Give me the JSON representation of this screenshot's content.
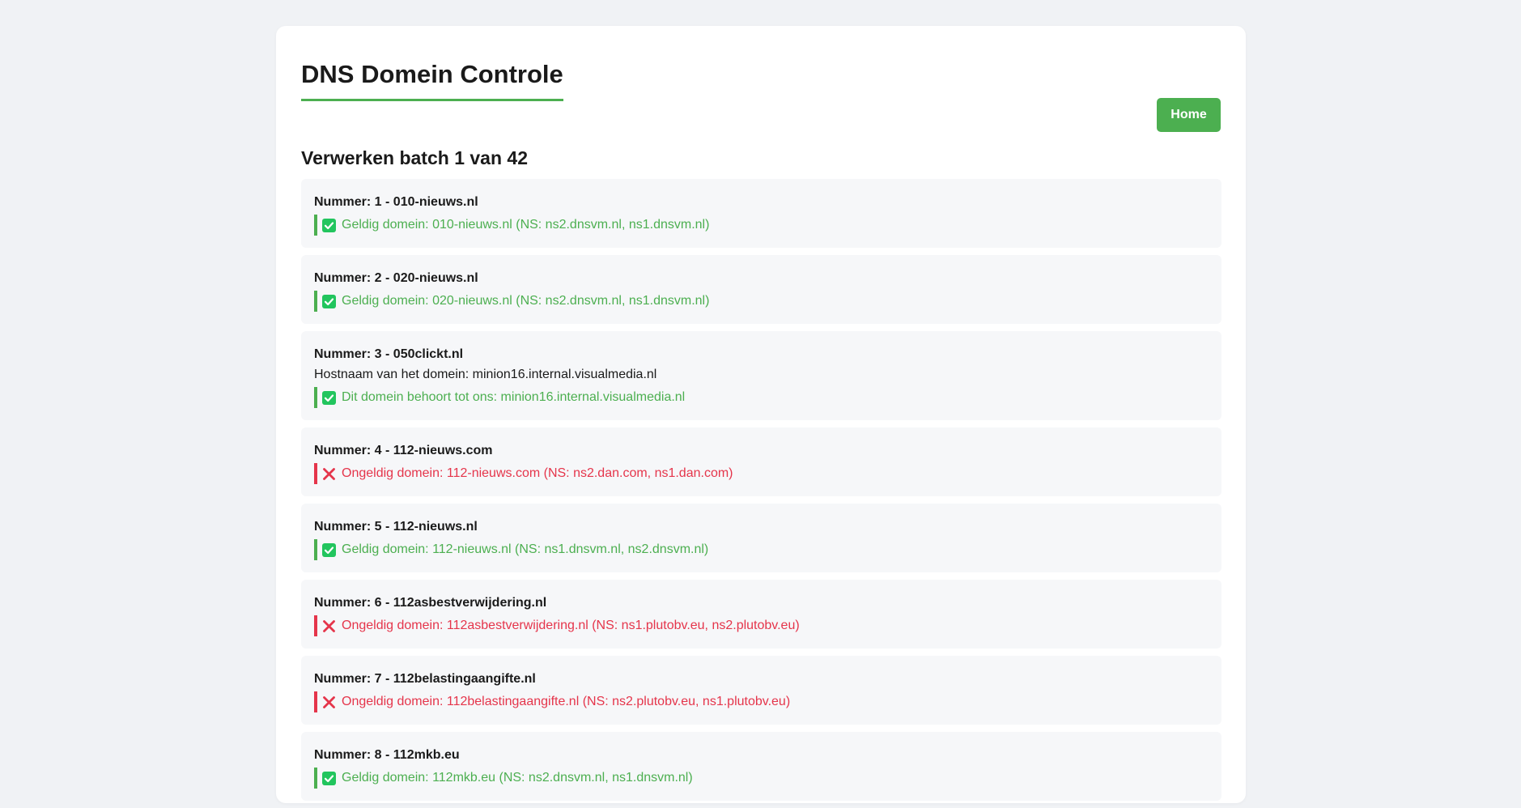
{
  "header": {
    "title": "DNS Domein Controle",
    "home_label": "Home"
  },
  "batch": {
    "title": "Verwerken batch 1 van 42"
  },
  "items": [
    {
      "title": "Nummer: 1 - 010-nieuws.nl",
      "status": "valid",
      "icon": "check-icon",
      "message": "Geldig domein: 010-nieuws.nl (NS: ns2.dnsvm.nl, ns1.dnsvm.nl)"
    },
    {
      "title": "Nummer: 2 - 020-nieuws.nl",
      "status": "valid",
      "icon": "check-icon",
      "message": "Geldig domein: 020-nieuws.nl (NS: ns2.dnsvm.nl, ns1.dnsvm.nl)"
    },
    {
      "title": "Nummer: 3 - 050clickt.nl",
      "hostname": "Hostnaam van het domein: minion16.internal.visualmedia.nl",
      "status": "valid",
      "icon": "check-icon",
      "message": "Dit domein behoort tot ons: minion16.internal.visualmedia.nl"
    },
    {
      "title": "Nummer: 4 - 112-nieuws.com",
      "status": "invalid",
      "icon": "cross-icon",
      "message": "Ongeldig domein: 112-nieuws.com (NS: ns2.dan.com, ns1.dan.com)"
    },
    {
      "title": "Nummer: 5 - 112-nieuws.nl",
      "status": "valid",
      "icon": "check-icon",
      "message": "Geldig domein: 112-nieuws.nl (NS: ns1.dnsvm.nl, ns2.dnsvm.nl)"
    },
    {
      "title": "Nummer: 6 - 112asbestverwijdering.nl",
      "status": "invalid",
      "icon": "cross-icon",
      "message": "Ongeldig domein: 112asbestverwijdering.nl (NS: ns1.plutobv.eu, ns2.plutobv.eu)"
    },
    {
      "title": "Nummer: 7 - 112belastingaangifte.nl",
      "status": "invalid",
      "icon": "cross-icon",
      "message": "Ongeldig domein: 112belastingaangifte.nl (NS: ns2.plutobv.eu, ns1.plutobv.eu)"
    },
    {
      "title": "Nummer: 8 - 112mkb.eu",
      "status": "valid",
      "icon": "check-icon",
      "message": "Geldig domein: 112mkb.eu (NS: ns2.dnsvm.nl, ns1.dnsvm.nl)"
    }
  ],
  "colors": {
    "accent": "#4caf50",
    "valid": "#4caf50",
    "invalid": "#e5354b",
    "background": "#f0f2f5",
    "item_background": "#f6f7f9"
  }
}
